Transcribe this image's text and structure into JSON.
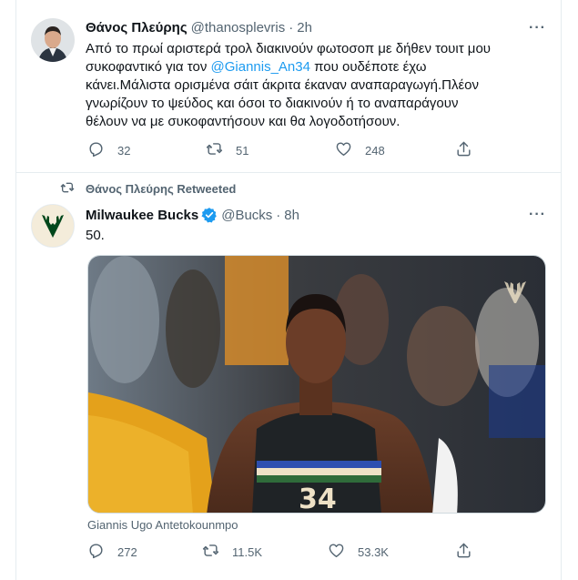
{
  "tweet1": {
    "author_name": "Θάνος Πλεύρης",
    "author_handle": "@thanosplevris",
    "separator": "·",
    "time": "2h",
    "text_line1": "Από το πρωί αριστερά τρολ διακινούν φωτοσοπ με δήθεν τουιτ μου",
    "text_line2_pre": "συκοφαντικό για τον ",
    "text_line2_mention": "@Giannis_An34",
    "text_line2_post": " που ουδέποτε έχω",
    "text_line3": "κάνει.Μάλιστα ορισμένα σάιτ άκριτα έκαναν αναπαραγωγή.Πλέον",
    "text_line4": "γνωρίζουν το ψεύδος και όσοι το διακινούν ή το αναπαράγουν",
    "text_line5": "θέλουν να με συκοφαντήσουν και θα λογοδοτήσουν.",
    "replies": "32",
    "retweets": "51",
    "likes": "248"
  },
  "tweet2": {
    "retweeted_by": "Θάνος Πλεύρης Retweeted",
    "author_name": "Milwaukee Bucks",
    "author_handle": "@Bucks",
    "separator": "·",
    "time": "8h",
    "text": "50.",
    "jersey_number": "34",
    "image_caption": "Giannis Ugo Antetokounmpo",
    "replies": "272",
    "retweets": "11.5K",
    "likes": "53.3K"
  },
  "more_glyph": "···",
  "icons": [
    "reply-icon",
    "retweet-icon",
    "like-icon",
    "share-icon",
    "verified-icon",
    "more-icon"
  ],
  "colors": {
    "accent": "#1d9bf0",
    "muted": "#536471",
    "text": "#0f1419",
    "border": "#e6ecf0",
    "bucks_green": "#00471b",
    "bucks_cream": "#eee1c6"
  }
}
